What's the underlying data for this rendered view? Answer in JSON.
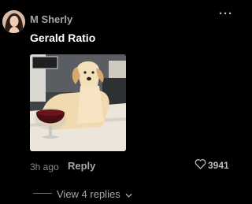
{
  "comment": {
    "username": "M Sherly",
    "text": "Gerald Ratio",
    "timestamp": "3h ago",
    "reply_label": "Reply",
    "like_count": "3941",
    "more_icon": "ellipsis-icon",
    "like_icon": "heart-outline-icon"
  },
  "replies": {
    "toggle_label": "View 4 replies",
    "toggle_icon": "chevron-down-icon"
  }
}
